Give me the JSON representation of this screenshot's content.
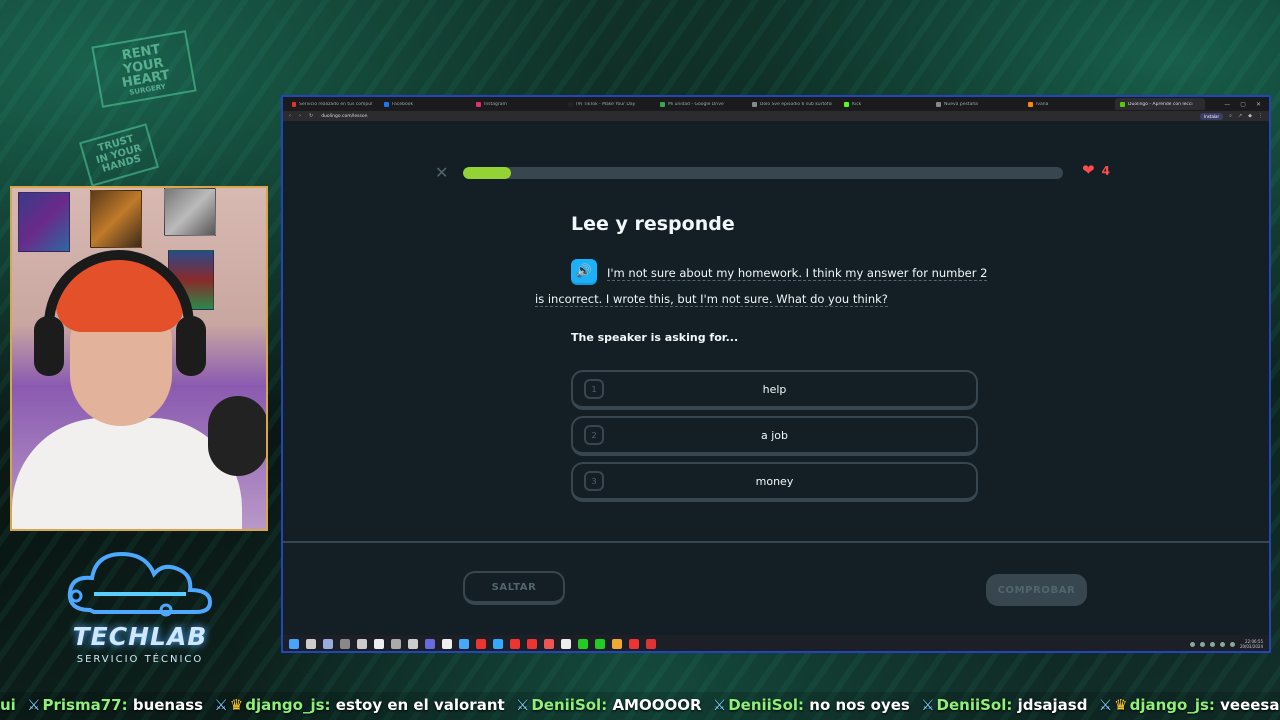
{
  "background_sign": {
    "line1": "RENT",
    "line2": "YOUR",
    "line3": "HEART",
    "line4": "SURGERY"
  },
  "background_sign2": {
    "line1": "TRUST",
    "line2": "IN YOUR",
    "line3": "HANDS"
  },
  "logo": {
    "title": "TECHLAB",
    "subtitle": "SERVICIO TÉCNICO"
  },
  "browser": {
    "tabs": [
      {
        "label": "Servicio realizado en tus computadoras",
        "color": "#d33"
      },
      {
        "label": "Facebook",
        "color": "#1877f2"
      },
      {
        "label": "Instagram",
        "color": "#e1306c"
      },
      {
        "label": "(9) TikTok - Make Your Day",
        "color": "#222"
      },
      {
        "label": "Mi unidad - Google Drive",
        "color": "#34a853"
      },
      {
        "label": "Dolo Sve episodio 6 sub kurtofor",
        "color": "#888"
      },
      {
        "label": "Kick",
        "color": "#53fc18"
      },
      {
        "label": "Nueva pestaña",
        "color": "#888"
      },
      {
        "label": "Ivana",
        "color": "#f80"
      },
      {
        "label": "Duolingo - Aprende con lecci",
        "color": "#58cc02",
        "active": true
      }
    ],
    "url": "duolingo.com/lesson",
    "install_label": "Instalar"
  },
  "lesson": {
    "progress_percent": 8,
    "hearts": "4",
    "title": "Lee y responde",
    "passage_line1": "I'm not sure about my homework. I think my answer for number 2",
    "passage_line2": "is incorrect. I wrote this, but I'm not sure. What do you think?",
    "question": "The speaker is asking for...",
    "options": [
      {
        "num": "1",
        "label": "help"
      },
      {
        "num": "2",
        "label": "a job"
      },
      {
        "num": "3",
        "label": "money"
      }
    ],
    "skip_label": "SALTAR",
    "check_label": "COMPROBAR"
  },
  "taskbar": {
    "time": "22:06:55",
    "date": "20/03/2024",
    "icons": [
      "#4aa3ff",
      "#ccc",
      "#9ad",
      "#888",
      "#ccc",
      "#eee",
      "#aaa",
      "#ccc",
      "#6a6adf",
      "#eee",
      "#4af",
      "#e33",
      "#3af",
      "#e33",
      "#e33",
      "#e55",
      "#eee",
      "#2c2",
      "#2c2",
      "#ea3",
      "#e33",
      "#d33"
    ]
  },
  "chat": [
    {
      "badge": "",
      "user": "",
      "prefix": "ui",
      "text": ""
    },
    {
      "badge": "sword",
      "user": "Prisma77:",
      "text": "buenass"
    },
    {
      "badge": "crown",
      "user": "django_js:",
      "text": "estoy en el valorant"
    },
    {
      "badge": "sword",
      "user": "DeniiSol:",
      "text": "AMOOOOR"
    },
    {
      "badge": "sword",
      "user": "DeniiSol:",
      "text": "no nos oyes"
    },
    {
      "badge": "sword",
      "user": "DeniiSol:",
      "text": "jdsajasd"
    },
    {
      "badge": "crown",
      "user": "django_js:",
      "text": "veeesa moida"
    }
  ],
  "colors": {
    "accent_green": "#93d333",
    "heart_red": "#ff4b4b",
    "speaker_blue": "#1cb0f6",
    "window_border": "#2445b8"
  }
}
